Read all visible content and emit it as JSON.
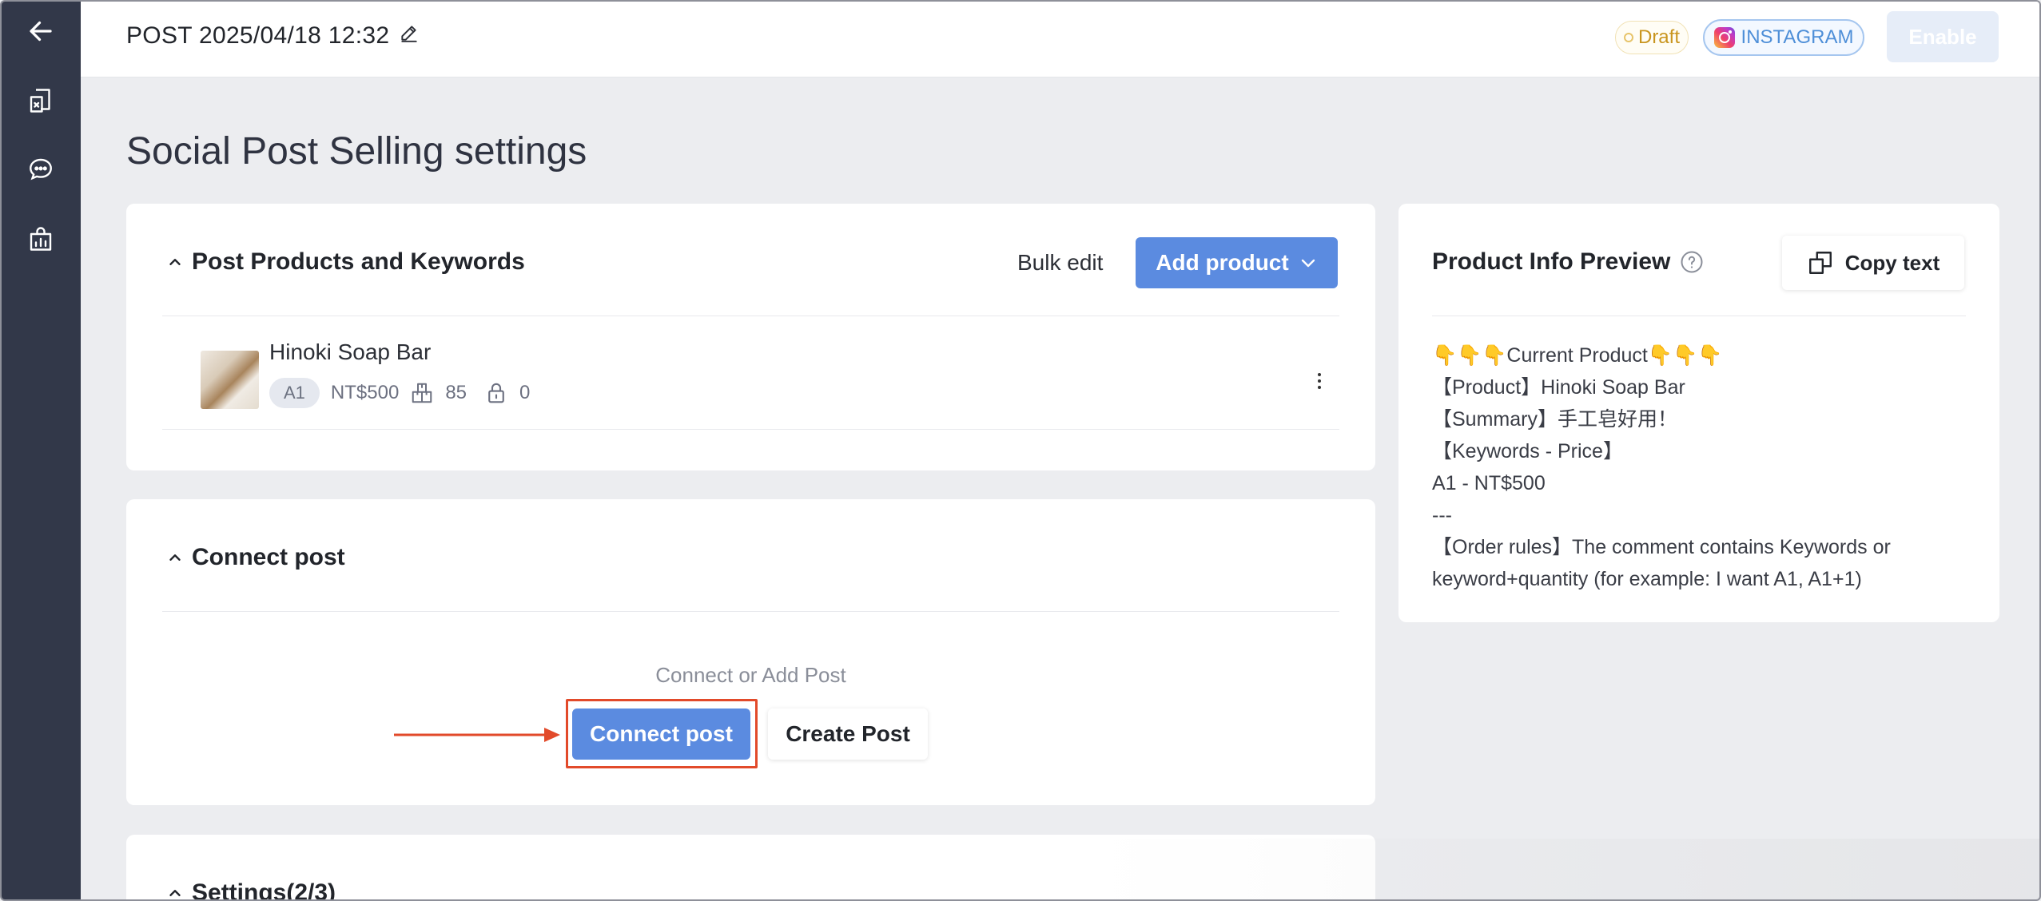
{
  "header": {
    "post_title": "POST 2025/04/18 12:32",
    "status_badge": "Draft",
    "platform_badge": "INSTAGRAM",
    "enable_label": "Enable"
  },
  "page": {
    "title": "Social Post Selling settings"
  },
  "products_section": {
    "title": "Post Products and Keywords",
    "bulk_edit_label": "Bulk edit",
    "add_product_label": "Add product",
    "items": [
      {
        "name": "Hinoki Soap Bar",
        "keyword": "A1",
        "price": "NT$500",
        "stock": "85",
        "locked": "0"
      }
    ]
  },
  "connect_section": {
    "title": "Connect post",
    "hint": "Connect or Add Post",
    "connect_label": "Connect post",
    "create_label": "Create Post"
  },
  "settings_section": {
    "title": "Settings(2/3)"
  },
  "preview": {
    "title": "Product Info Preview",
    "copy_label": "Copy text",
    "lines": [
      "👇👇👇Current Product👇👇👇",
      "【Product】Hinoki Soap Bar",
      "【Summary】手工皂好用！",
      "【Keywords - Price】",
      "A1 - NT$500",
      "---",
      "【Order rules】The comment contains Keywords or",
      "keyword+quantity (for example: I want A1, A1+1)"
    ]
  },
  "colors": {
    "sidebar": "#323849",
    "primary": "#5b8be0",
    "highlight": "#e24a2a",
    "draft": "#c9951e",
    "instagram": "#4e8fd8"
  }
}
